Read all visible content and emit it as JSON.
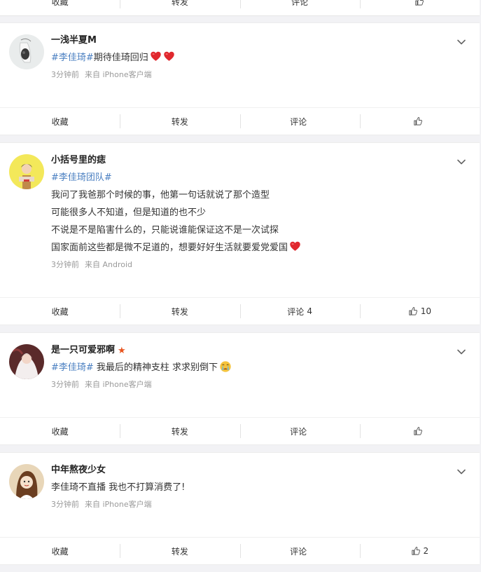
{
  "actions": {
    "collect": "收藏",
    "repost": "转发",
    "comment": "评论"
  },
  "colors": {
    "hashtag": "#4a7fc1",
    "heart": "#e0282e",
    "star": "#e8541e",
    "meta": "#9a9a9a",
    "background": "#f2f2f5"
  },
  "icons": {
    "expand": "chevron-down-icon",
    "like": "thumbs-up-icon",
    "heart": "red-heart-emoji",
    "cry": "crying-face-emoji"
  },
  "posts": [
    {
      "username": "一浅半夏M",
      "text_hashtag": "#李佳琦#",
      "text": "期待佳琦回归",
      "time": "3分钟前",
      "source": "来自 iPhone客户端",
      "comment_count": "",
      "like_count": ""
    },
    {
      "username": "小括号里的痣",
      "hashtag_line": "#李佳琦团队#",
      "lines": [
        "我问了我爸那个时候的事，他第一句话就说了那个造型",
        "可能很多人不知道，但是知道的也不少",
        "不说是不是陷害什么的，只能说谁能保证这不是一次试探",
        "国家面前这些都是微不足道的，想要好好生活就要爱党爱国"
      ],
      "time": "3分钟前",
      "source": "来自 Android",
      "comment_count": "4",
      "like_count": "10"
    },
    {
      "username": "是一只可爱邪啊",
      "text_hashtag": "#李佳琦#",
      "text": " 我最后的精神支柱 求求别倒下",
      "time": "3分钟前",
      "source": "来自 iPhone客户端",
      "comment_count": "",
      "like_count": ""
    },
    {
      "username": "中年熬夜少女",
      "text": "李佳琦不直播 我也不打算消费了!",
      "time": "3分钟前",
      "source": "来自 iPhone客户端",
      "comment_count": "",
      "like_count": "2"
    }
  ]
}
